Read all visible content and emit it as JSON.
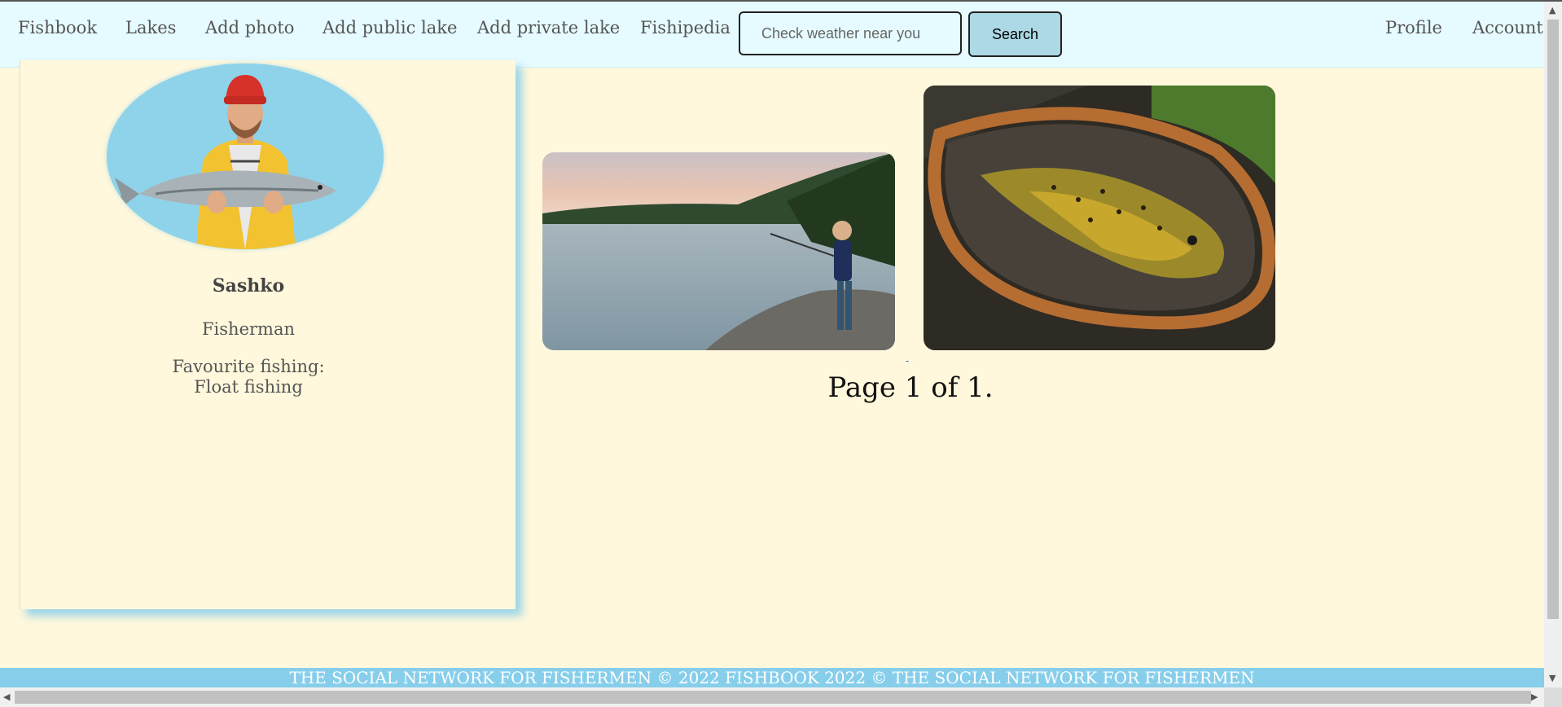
{
  "nav": {
    "brand": "Fishbook",
    "lakes": "Lakes",
    "add_photo": "Add photo",
    "add_public_lake": "Add public lake",
    "add_private_lake": "Add private lake",
    "fishipedia": "Fishipedia",
    "profile": "Profile",
    "account": "Account"
  },
  "search": {
    "placeholder": "Check weather near you",
    "value": "",
    "button_label": "Search"
  },
  "profile": {
    "name": "Sashko",
    "title": "Fisherman",
    "favourite_fishing": "Favourite fishing: Float fishing"
  },
  "gallery": {
    "pager_dash": "-",
    "page_label": "Page 1 of 1."
  },
  "footer": {
    "text": "THE SOCIAL NETWORK FOR FISHERMEN © 2022 FISHBOOK 2022 © THE SOCIAL NETWORK FOR FISHERMEN"
  },
  "colors": {
    "page_bg": "#fff8dc",
    "nav_bg": "#e6fbff",
    "accent": "#87ceeb",
    "search_button_bg": "#add8e6"
  },
  "icons": {
    "scroll_up": "chevron-up-icon",
    "scroll_down": "chevron-down-icon",
    "scroll_left": "chevron-left-icon",
    "scroll_right": "chevron-right-icon"
  }
}
